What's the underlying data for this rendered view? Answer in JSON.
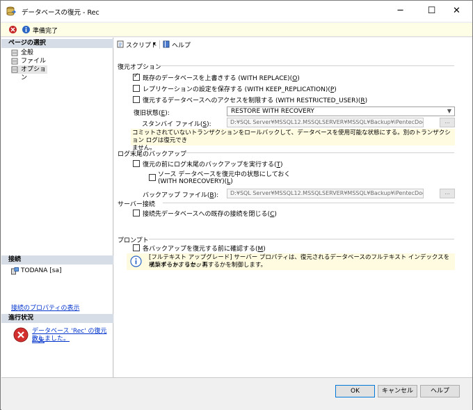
{
  "window": {
    "title": "データベースの復元 - Rec",
    "minimize_glyph": "─",
    "maximize_glyph": "☐",
    "close_glyph": "✕"
  },
  "status": {
    "text": "準備完了"
  },
  "left": {
    "page_select_header": "ページの選択",
    "pages": [
      "全般",
      "ファイル",
      "オプション"
    ],
    "connection_header": "接続",
    "connection_item": "TODANA [sa]",
    "connection_link": "接続のプロパティの表示",
    "progress_header": "進行状況",
    "progress_message_line1": "データベース 'Rec' の復元に失",
    "progress_message_line2": "敗しました。"
  },
  "toolbar": {
    "script_label": "スクリプト",
    "script_arrow": "▾",
    "help_label": "ヘルプ"
  },
  "restore_options": {
    "group_label": "復元オプション",
    "overwrite_label": "既存のデータベースを上書きする (WITH REPLACE)(",
    "overwrite_key": "O",
    "overwrite_checked": true,
    "keep_replication_label": "レプリケーションの設定を保存する (WITH KEEP_REPLICATION)(",
    "keep_replication_key": "P",
    "restricted_label": "復元するデータベースへのアクセスを制限する (WITH RESTRICTED_USER)(",
    "restricted_key": "R",
    "recovery_state_label": "復旧状態(",
    "recovery_state_key": "E",
    "recovery_state_suffix": "):",
    "recovery_state_value": "RESTORE WITH RECOVERY",
    "standby_file_label": "スタンバイ ファイル(",
    "standby_file_key": "S",
    "standby_file_suffix": "):",
    "standby_file_value": "D:¥SQL Server¥MSSQL12.MSSQLSERVER¥MSSQL¥Backup¥iPentecDoc",
    "browse_label": "...",
    "note_line1": "コミットされていないトランザクションをロールバックして、データベースを使用可能な状態にする。別のトランザクション ログは復元でき",
    "note_line2": "ません。"
  },
  "tail_log": {
    "group_label": "ログ末尾のバックアップ",
    "backup_before_label": "復元の前にログ末尾のバックアップを実行する(",
    "backup_before_key": "T",
    "norecovery_line1": "ソース データベースを復元中の状態にしておく",
    "norecovery_line2": "(WITH NORECOVERY)(",
    "norecovery_key": "L",
    "backup_file_label": "バックアップ ファイル(",
    "backup_file_key": "B",
    "backup_file_suffix": "):",
    "backup_file_value": "D:¥SQL Server¥MSSQL12.MSSQLSERVER¥MSSQL¥Backup¥iPentecDoc",
    "browse_label": "..."
  },
  "server_connections": {
    "group_label": "サーバー接続",
    "close_connections_label": "接続先データベースへの既存の接続を閉じる(",
    "close_connections_key": "C"
  },
  "prompt": {
    "group_label": "プロンプト",
    "confirm_label": "各バックアップを復元する前に確認する(",
    "confirm_key": "M",
    "info_line1": "[フルテキスト アップグレード] サーバー プロパティは、復元されるデータベースのフルテキスト インデックスをインポートするか、再",
    "info_line2": "構築するか、リセットするかを制御します。"
  },
  "buttons": {
    "ok": "OK",
    "cancel": "キャンセル",
    "help": "ヘルプ"
  },
  "colors": {
    "link": "#0033cc",
    "error": "#d32f2f",
    "header_bg": "#d7dde6",
    "note_bg": "#fffbe0"
  }
}
